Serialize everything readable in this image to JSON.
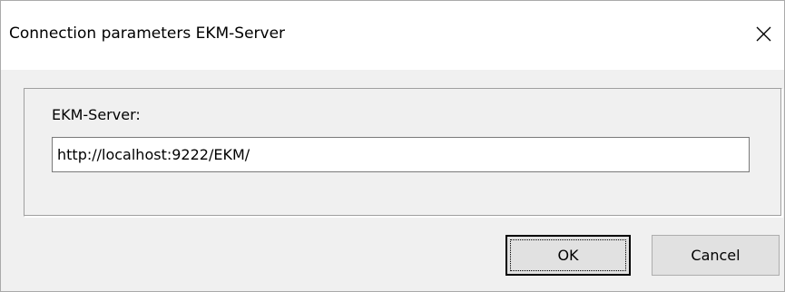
{
  "dialog": {
    "title": "Connection parameters EKM-Server",
    "close_icon": "close-icon"
  },
  "form": {
    "server_label": "EKM-Server:",
    "server_value": "http://localhost:9222/EKM/"
  },
  "buttons": {
    "ok_label": "OK",
    "cancel_label": "Cancel"
  }
}
